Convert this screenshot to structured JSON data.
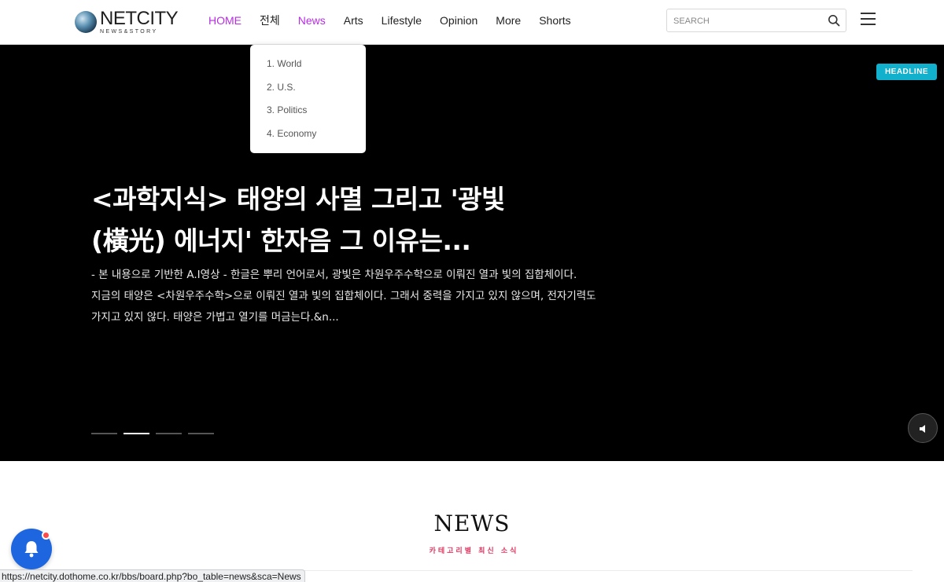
{
  "logo": {
    "main": "NETCITY",
    "sub": "NEWS&STORY"
  },
  "nav": {
    "items": [
      "HOME",
      "전체",
      "News",
      "Arts",
      "Lifestyle",
      "Opinion",
      "More",
      "Shorts"
    ],
    "active_color": "#b82ce6"
  },
  "search": {
    "placeholder": "SEARCH"
  },
  "dropdown": {
    "items": [
      "1. World",
      "2. U.S.",
      "3. Politics",
      "4. Economy"
    ]
  },
  "hero": {
    "badge": "HEADLINE",
    "title_line1": "<과학지식> 태양의 사멸 그리고 '광빛",
    "title_line2": "(橫光) 에너지' 한자음 그 이유는...",
    "desc_line1": "- 본 내용으로 기반한 A.I영상 -   한글은 뿌리 언어로서, 광빛은 차원우주수학으로 이뤄진 열과 빛의 집합체이다.",
    "desc_line2": "지금의 태양은 <차원우주수학>으로 이뤄진 열과 빛의 집합체이다. 그래서 중력을 가지고 있지 않으며, 전자기력도",
    "desc_line3": "가지고 있지 않다. 태양은 가볍고 열기를 머금는다.&n...",
    "slide_count": 4,
    "active_slide": 2,
    "badge_color": "#11b0cc"
  },
  "news_section": {
    "title": "NEWS",
    "subtitle": "카테고리별 최신 소식",
    "subtitle_color": "#e0355f"
  },
  "status_bar": {
    "url": "https://netcity.dothome.co.kr/bbs/board.php?bo_table=news&sca=News"
  }
}
